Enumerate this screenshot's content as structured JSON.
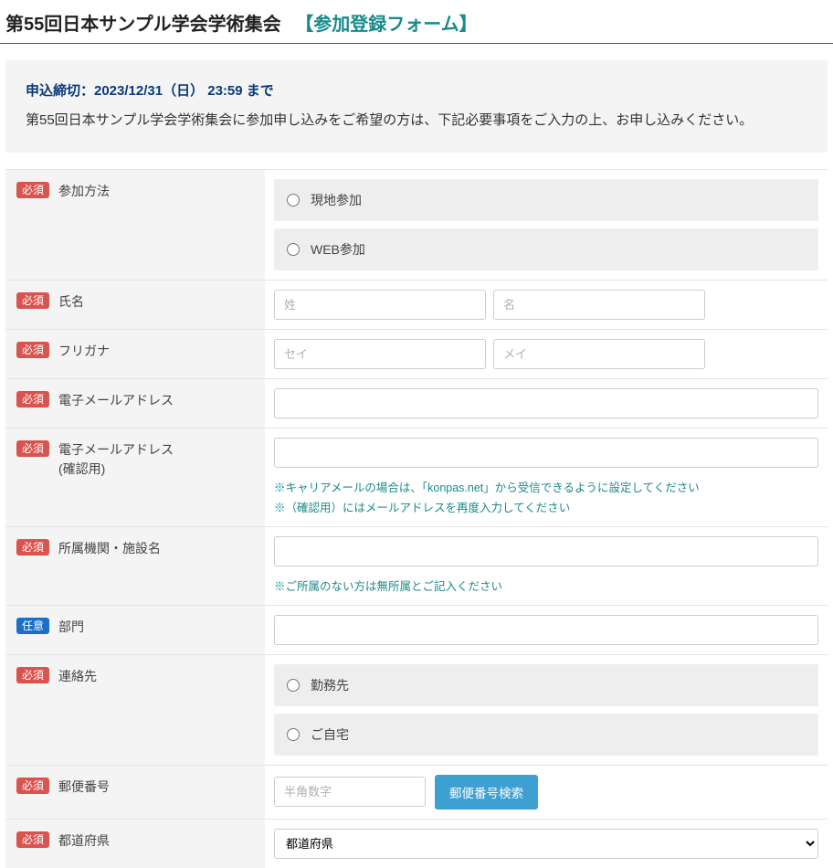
{
  "title": {
    "main": "第55回日本サンプル学会学術集会",
    "sub": "【参加登録フォーム】"
  },
  "notice": {
    "deadline": "申込締切：2023/12/31（日） 23:59 まで",
    "text": "第55回日本サンプル学会学術集会に参加申し込みをご希望の方は、下記必要事項をご入力の上、お申し込みください。"
  },
  "badges": {
    "required": "必須",
    "optional": "任意"
  },
  "labels": {
    "method": "参加方法",
    "name": "氏名",
    "kana": "フリガナ",
    "email": "電子メールアドレス",
    "email_confirm": "電子メールアドレス\n(確認用)",
    "org": "所属機関・施設名",
    "dept": "部門",
    "contact": "連絡先",
    "zip": "郵便番号",
    "pref": "都道府県"
  },
  "options": {
    "method_onsite": "現地参加",
    "method_web": "WEB参加",
    "contact_work": "勤務先",
    "contact_home": "ご自宅"
  },
  "placeholders": {
    "sei": "姓",
    "mei": "名",
    "sei_kana": "セイ",
    "mei_kana": "メイ",
    "zip": "半角数字"
  },
  "hints": {
    "email1": "※キャリアメールの場合は、「konpas.net」から受信できるように設定してください",
    "email2": "※（確認用）にはメールアドレスを再度入力してください",
    "org": "※ご所属のない方は無所属とご記入ください"
  },
  "buttons": {
    "zip_search": "郵便番号検索"
  },
  "select": {
    "pref_default": "都道府県"
  }
}
